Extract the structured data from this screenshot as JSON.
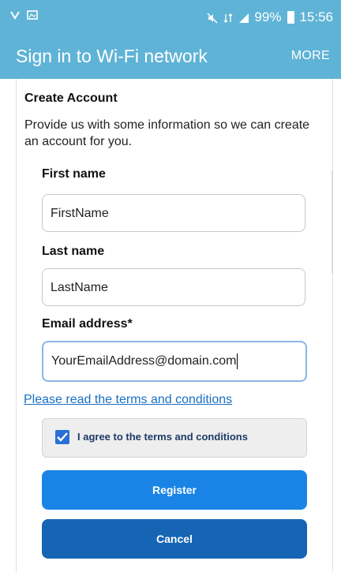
{
  "status_bar": {
    "battery_percent": "99%",
    "time": "15:56",
    "left_icons": [
      "notification-icon",
      "image-icon"
    ],
    "right_icons": [
      "mute-icon",
      "lte-icon",
      "signal-icon",
      "battery-icon"
    ]
  },
  "app_bar": {
    "title": "Sign in to Wi-Fi network",
    "more_label": "MORE",
    "color": "#5fb3d6"
  },
  "form": {
    "section_title": "Create Account",
    "intro": "Provide us with some information so we can create an account for you.",
    "first_name": {
      "label": "First name",
      "value": "FirstName"
    },
    "last_name": {
      "label": "Last name",
      "value": "LastName"
    },
    "email": {
      "label": "Email address*",
      "value": "YourEmailAddress@domain.com"
    },
    "terms_link": "Please read the terms and conditions",
    "agree_label": "I agree to the terms and conditions",
    "agree_checked": true,
    "register_label": "Register",
    "cancel_label": "Cancel"
  },
  "colors": {
    "link": "#1a6fc4",
    "register_button": "#1a84e6",
    "cancel_button": "#1565b4",
    "checkbox": "#2a6fd6"
  }
}
